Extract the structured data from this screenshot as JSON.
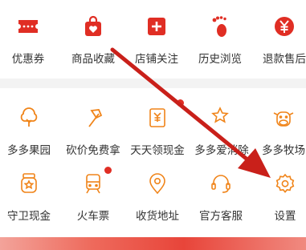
{
  "colors": {
    "accent": "#e02e24",
    "icon_stroke": "#f08419",
    "arrow": "#c9201a",
    "divider": "#f3f3f3"
  },
  "top_row": [
    {
      "label": "优惠券",
      "icon": "coupon-icon"
    },
    {
      "label": "商品收藏",
      "icon": "shopping-bag-heart-icon"
    },
    {
      "label": "店铺关注",
      "icon": "store-plus-icon"
    },
    {
      "label": "历史浏览",
      "icon": "footprint-icon"
    },
    {
      "label": "退款售后",
      "icon": "yen-coin-icon"
    }
  ],
  "grid_row1": [
    {
      "label": "多多果园",
      "icon": "tree-icon"
    },
    {
      "label": "砍价免费拿",
      "icon": "axe-icon"
    },
    {
      "label": "天天领现金",
      "icon": "cash-envelope-icon",
      "badge": true
    },
    {
      "label": "多多爱消除",
      "icon": "star-tap-icon"
    },
    {
      "label": "多多牧场",
      "icon": "cow-icon"
    }
  ],
  "grid_row2": [
    {
      "label": "守卫现金",
      "icon": "money-jar-icon"
    },
    {
      "label": "火车票",
      "icon": "train-icon",
      "badge": true
    },
    {
      "label": "收货地址",
      "icon": "location-pin-icon"
    },
    {
      "label": "官方客服",
      "icon": "headset-icon"
    },
    {
      "label": "设置",
      "icon": "settings-gear-icon"
    }
  ]
}
